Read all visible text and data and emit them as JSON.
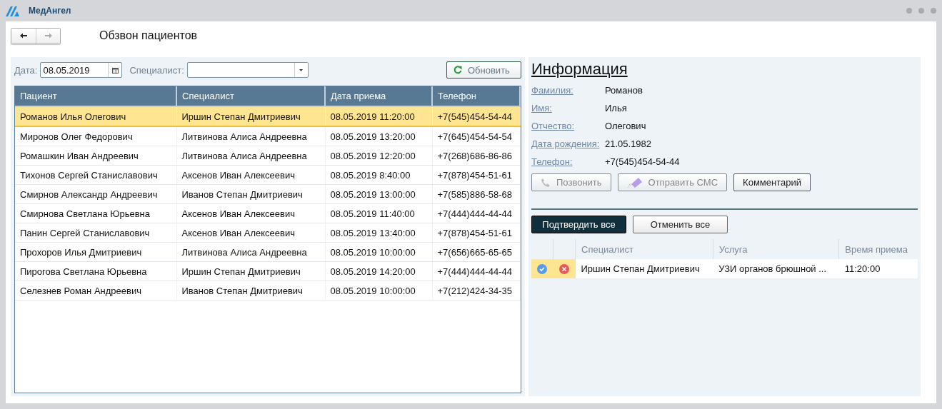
{
  "app": {
    "name": "МедАнгел"
  },
  "nav": [
    {
      "kind": "back",
      "disabled": false
    },
    {
      "kind": "forward",
      "disabled": true
    }
  ],
  "page_title": "Обзвон пациентов",
  "filter": {
    "date_label": "Дата:",
    "date_value": "08.05.2019",
    "specialist_label": "Специалист:"
  },
  "refresh_button": "Обновить",
  "patients": {
    "columns": [
      "Пациент",
      "Специалист",
      "Дата приема",
      "Телефон"
    ],
    "rows": [
      {
        "selected": true,
        "cells": [
          "Романов Илья Олегович",
          "Иршин Степан Дмитриевич",
          "08.05.2019 11:20:00",
          "+7(545)454-54-44"
        ]
      },
      {
        "selected": false,
        "cells": [
          "Миронов Олег Федорович",
          "Литвинова Алиса Андреевна",
          "08.05.2019 13:20:00",
          "+7(645)454-54-54"
        ]
      },
      {
        "selected": false,
        "cells": [
          "Ромашкин Иван Андреевич",
          "Литвинова Алиса Андреевна",
          "08.05.2019 12:20:00",
          "+7(268)686-86-86"
        ]
      },
      {
        "selected": false,
        "cells": [
          "Тихонов Сергей Станиславович",
          "Аксенов Иван Алексеевич",
          "08.05.2019 8:40:00",
          "+7(878)454-51-61"
        ]
      },
      {
        "selected": false,
        "cells": [
          "Смирнов Александр Андреевич",
          "Иванов Степан Дмитриевич",
          "08.05.2019 13:00:00",
          "+7(585)886-58-68"
        ]
      },
      {
        "selected": false,
        "cells": [
          "Смирнова Светлана Юрьевна",
          "Аксенов Иван Алексеевич",
          "08.05.2019 11:40:00",
          "+7(444)444-44-44"
        ]
      },
      {
        "selected": false,
        "cells": [
          "Панин Сергей Станиславович",
          "Аксенов Иван Алексеевич",
          "08.05.2019 13:40:00",
          "+7(878)454-51-61"
        ]
      },
      {
        "selected": false,
        "cells": [
          "Прохоров Илья Дмитриевич",
          "Литвинова Алиса Андреевна",
          "08.05.2019 10:00:00",
          "+7(656)665-65-65"
        ]
      },
      {
        "selected": false,
        "cells": [
          "Пирогова Светлана Юрьевна",
          "Иршин Степан Дмитриевич",
          "08.05.2019 14:20:00",
          "+7(444)444-44-44"
        ]
      },
      {
        "selected": false,
        "cells": [
          "Селезнев Роман Андреевич",
          "Иванов Степан Дмитриевич",
          "08.05.2019 10:00:00",
          "+7(212)424-34-35"
        ]
      }
    ]
  },
  "info": {
    "title": "Информация",
    "fields": [
      {
        "label": "Фамилия:",
        "value": "Романов"
      },
      {
        "label": "Имя:",
        "value": "Илья"
      },
      {
        "label": "Отчество:",
        "value": "Олегович"
      },
      {
        "label": "Дата рождения:",
        "value": "21.05.1982"
      },
      {
        "label": "Телефон:",
        "value": "+7(545)454-54-44"
      }
    ],
    "actions": [
      {
        "kind": "call",
        "label": "Позвонить",
        "disabled": true
      },
      {
        "kind": "sms",
        "label": "Отправить СМС",
        "disabled": true
      },
      {
        "kind": "comment",
        "label": "Комментарий",
        "disabled": false
      }
    ]
  },
  "confirm_all_button": "Подтвердить все",
  "cancel_all_button": "Отменить все",
  "appointments": {
    "columns": [
      "Специалист",
      "Услуга",
      "Время приема"
    ],
    "rows": [
      {
        "specialist": "Иршин Степан Дмитриевич",
        "service": "УЗИ органов брюшной ...",
        "time": "11:20:00"
      }
    ]
  }
}
